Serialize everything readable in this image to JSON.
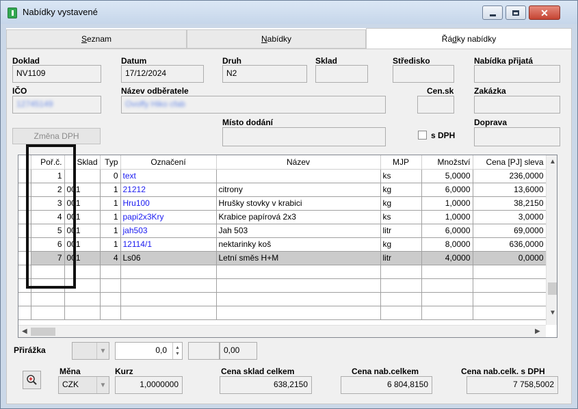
{
  "window": {
    "title": "Nabídky vystavené"
  },
  "tabs": [
    {
      "pre": "",
      "acc": "S",
      "post": "eznam"
    },
    {
      "pre": "",
      "acc": "N",
      "post": "abídky"
    },
    {
      "pre": "Řá",
      "acc": "d",
      "post": "ky nabídky"
    }
  ],
  "header": {
    "doklad_label": "Doklad",
    "doklad_value": "NV1109",
    "datum_label": "Datum",
    "datum_value": "17/12/2024",
    "druh_label": "Druh",
    "druh_value": "N2",
    "sklad_label": "Sklad",
    "sklad_value": "",
    "stredisko_label": "Středisko",
    "stredisko_value": "",
    "nabidka_prijata_label": "Nabídka přijatá",
    "nabidka_prijata_value": "",
    "ico_label": "IČO",
    "ico_value": "12745149",
    "nazev_odberatele_label": "Název odběratele",
    "nazev_odberatele_value": "Ovoffy Hiko cfab",
    "censk_label": "Cen.sk",
    "censk_value": "",
    "zakazka_label": "Zakázka",
    "zakazka_value": "",
    "misto_dodani_label": "Místo dodání",
    "misto_dodani_value": "",
    "sdph_label": "s DPH",
    "doprava_label": "Doprava",
    "doprava_value": "",
    "zmena_dph_label": "Změna DPH"
  },
  "grid": {
    "columns": [
      "Poř.č.",
      "Sklad",
      "Typ",
      "Označení",
      "Název",
      "MJP",
      "Množství",
      "Cena [PJ] sleva"
    ],
    "rows": [
      {
        "por": "1",
        "sklad": "",
        "typ": "0",
        "oznaceni": "text",
        "nazev": "",
        "mjp": "ks",
        "mnozstvi": "5,0000",
        "cena": "236,0000"
      },
      {
        "por": "2",
        "sklad": "001",
        "typ": "1",
        "oznaceni": "21212",
        "nazev": "citrony",
        "mjp": "kg",
        "mnozstvi": "6,0000",
        "cena": "13,6000"
      },
      {
        "por": "3",
        "sklad": "001",
        "typ": "1",
        "oznaceni": "Hru100",
        "nazev": "Hrušky stovky v krabici",
        "mjp": "kg",
        "mnozstvi": "1,0000",
        "cena": "38,2150"
      },
      {
        "por": "4",
        "sklad": "001",
        "typ": "1",
        "oznaceni": "papi2x3Kry",
        "nazev": "Krabice papírová 2x3",
        "mjp": "ks",
        "mnozstvi": "1,0000",
        "cena": "3,0000"
      },
      {
        "por": "5",
        "sklad": "001",
        "typ": "1",
        "oznaceni": "jah503",
        "nazev": "Jah 503",
        "mjp": "litr",
        "mnozstvi": "6,0000",
        "cena": "69,0000"
      },
      {
        "por": "6",
        "sklad": "001",
        "typ": "1",
        "oznaceni": "12114/1",
        "nazev": "nektarinky koš",
        "mjp": "kg",
        "mnozstvi": "8,0000",
        "cena": "636,0000"
      },
      {
        "por": "7",
        "sklad": "001",
        "typ": "4",
        "oznaceni": "Ls06",
        "nazev": "Letní směs H+M",
        "mjp": "litr",
        "mnozstvi": "4,0000",
        "cena": "0,0000"
      }
    ]
  },
  "footer": {
    "prirazka_label": "Přirážka",
    "prirazka_combo": "",
    "prirazka_value": "0,0",
    "prirazka_blank": "",
    "prirazka_amount": "0,00",
    "mena_label": "Měna",
    "mena_value": "CZK",
    "kurz_label": "Kurz",
    "kurz_value": "1,0000000",
    "cena_sklad_label": "Cena sklad celkem",
    "cena_sklad_value": "638,2150",
    "cena_nab_label": "Cena nab.celkem",
    "cena_nab_value": "6 804,8150",
    "cena_nab_dph_label": "Cena nab.celk. s DPH",
    "cena_nab_dph_value": "7 758,5002"
  }
}
